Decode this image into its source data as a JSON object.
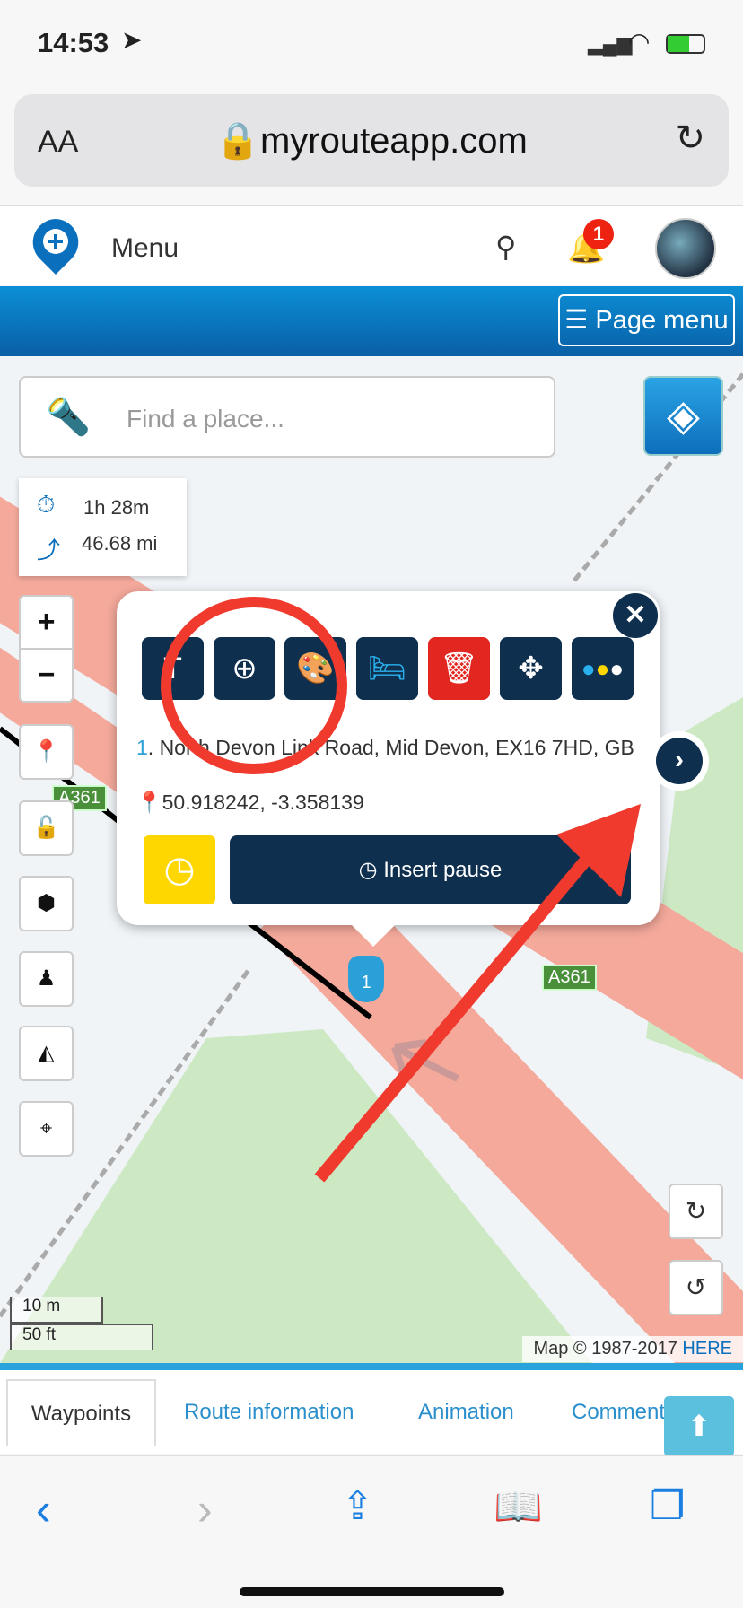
{
  "status": {
    "time": "14:53"
  },
  "browser": {
    "text_size": "AA",
    "url": "myrouteapp.com"
  },
  "header": {
    "menu": "Menu",
    "notifications": "1"
  },
  "bluebar": {
    "page_menu": "☰ Page menu"
  },
  "map": {
    "search_placeholder": "Find a place...",
    "stats": {
      "duration": "1h 28m",
      "distance": "46.68 mi"
    },
    "road_label": "A361",
    "scale": {
      "metric": "10 m",
      "imperial": "50 ft"
    },
    "attribution": "Map © 1987-2017",
    "attribution_link": "HERE",
    "waypoint_number": "1"
  },
  "popup": {
    "index": "1",
    "address": ". North Devon Link Road, Mid Devon, EX16 7HD, GB",
    "coordinates": "50.918242, -3.358139",
    "insert_pause": "Insert pause",
    "tools": [
      "rename",
      "zoom-in",
      "color",
      "overnight-stay",
      "delete",
      "move",
      "more"
    ]
  },
  "tabs": [
    "Waypoints",
    "Route information",
    "Animation",
    "Comments"
  ],
  "colors": {
    "navy": "#0e2f4e",
    "accent": "#29a3dc",
    "delete": "#e22620",
    "pause": "#fed700",
    "annotation": "#f03a2e"
  }
}
